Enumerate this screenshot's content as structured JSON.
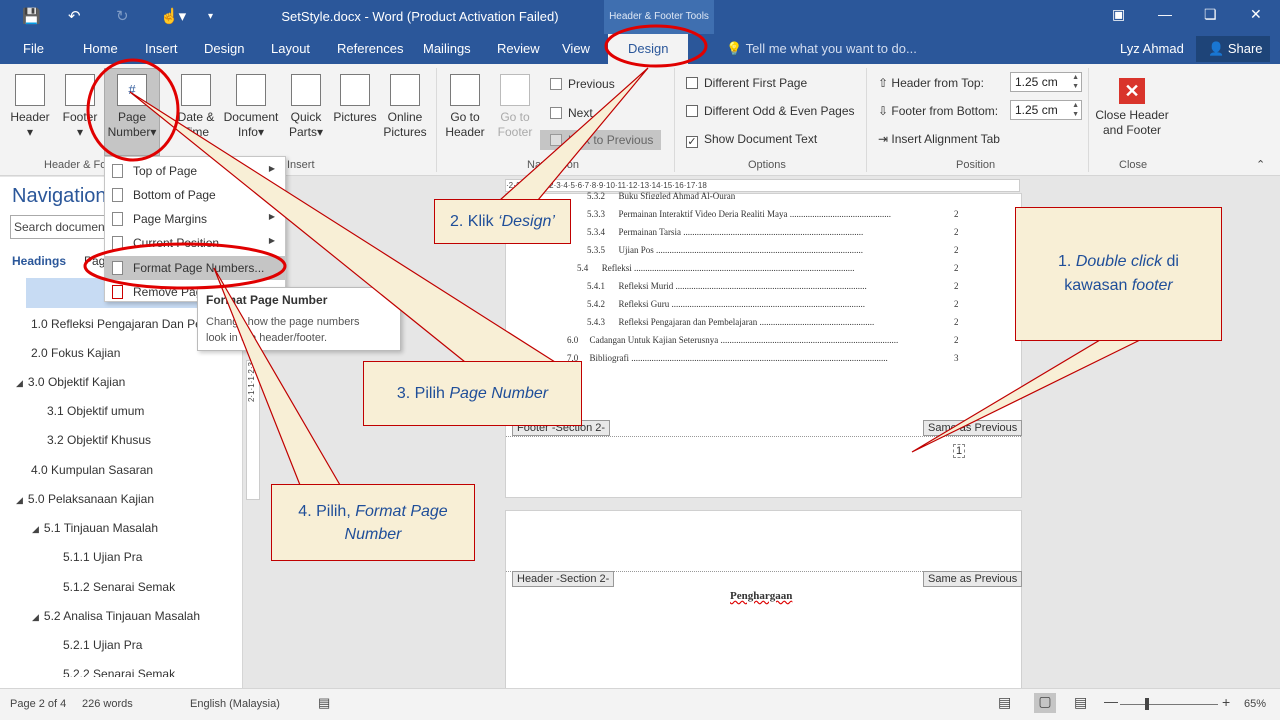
{
  "titlebar": {
    "title": "SetStyle.docx - Word (Product Activation Failed)",
    "context_tab": "Header & Footer Tools"
  },
  "tabs": {
    "file": "File",
    "home": "Home",
    "insert": "Insert",
    "design_doc": "Design",
    "layout": "Layout",
    "references": "References",
    "mailings": "Mailings",
    "review": "Review",
    "view": "View",
    "design_active": "Design",
    "tell_me": "Tell me what you want to do...",
    "user": "Lyz Ahmad",
    "share": "Share"
  },
  "ribbon": {
    "header": "Header",
    "footer": "Footer",
    "page_number_1": "Page",
    "page_number_2": "Number",
    "date_time_1": "Date &",
    "date_time_2": "Time",
    "document_info_1": "Document",
    "document_info_2": "Info",
    "quick_parts_1": "Quick",
    "quick_parts_2": "Parts",
    "pictures": "Pictures",
    "online_pictures_1": "Online",
    "online_pictures_2": "Pictures",
    "goto_header_1": "Go to",
    "goto_header_2": "Header",
    "goto_footer_1": "Go to",
    "goto_footer_2": "Footer",
    "previous": "Previous",
    "next": "Next",
    "link_to_previous": "Link to Previous",
    "different_first_page": "Different First Page",
    "different_odd_even": "Different Odd & Even Pages",
    "show_document_text": "Show Document Text",
    "header_from_top": "Header from Top:",
    "header_from_top_value": "1.25 cm",
    "footer_from_bottom": "Footer from Bottom:",
    "footer_from_bottom_value": "1.25 cm",
    "insert_alignment_tab": "Insert Alignment Tab",
    "close_1": "Close Header",
    "close_2": "and Footer",
    "group_header_footer": "Header & Fo",
    "group_insert": "Insert",
    "group_navigation": "Navigation",
    "group_options": "Options",
    "group_position": "Position",
    "group_close": "Close"
  },
  "dropdown": {
    "top_of_page": "Top of Page",
    "bottom_of_page": "Bottom of Page",
    "page_margins": "Page Margins",
    "current_position": "Current Position",
    "format_page_numbers": "Format Page Numbers...",
    "remove": "Remove Pag"
  },
  "tooltip": {
    "title": "Format Page Number",
    "desc_1": "Change how the page numbers",
    "desc_2": "look in the header/footer."
  },
  "nav": {
    "title": "Navigation",
    "search_placeholder": "Search document",
    "tab_headings": "Headings",
    "tab_pages": "Pag",
    "items": [
      "1.0 Refleksi Pengajaran Dan Pem",
      "2.0 Fokus Kajian",
      "3.0 Objektif Kajian",
      "3.1 Objektif umum",
      "3.2 Objektif Khusus",
      "4.0 Kumpulan Sasaran",
      "5.0 Pelaksanaan Kajian",
      "5.1 Tinjauan Masalah",
      "5.1.1 Ujian Pra",
      "5.1.2 Senarai Semak",
      "5.2 Analisa Tinjauan Masalah",
      "5.2.1 Ujian Pra",
      "5.2.2 Senarai Semak"
    ]
  },
  "ruler": {
    "h": "·2·1·1·1·  ·1·2·3·4·5·6·7·8·9·10·11·12·13·14·15·16·17·18",
    "v": "2·1·1·1·2·3"
  },
  "document": {
    "toc": [
      {
        "num": "5.3.2",
        "text": "Buku Sfiggled Ahmad Al-Quran",
        "page": "2"
      },
      {
        "num": "5.3.3",
        "text": "Permainan Interaktif Video Deria Realiti Maya",
        "page": "2"
      },
      {
        "num": "5.3.4",
        "text": "Permainan Tarsia",
        "page": "2"
      },
      {
        "num": "5.3.5",
        "text": "Ujian Pos",
        "page": "2"
      },
      {
        "num": "5.4",
        "text": "Refleksi",
        "page": "2"
      },
      {
        "num": "5.4.1",
        "text": "Refleksi Murid",
        "page": "2"
      },
      {
        "num": "5.4.2",
        "text": "Refleksi Guru",
        "page": "2"
      },
      {
        "num": "5.4.3",
        "text": "Refleksi Pengajaran dan Pembelajaran",
        "page": "2"
      },
      {
        "num": "6.0",
        "text": "Cadangan Untuk Kajian Seterusnya",
        "page": "2"
      },
      {
        "num": "7.0",
        "text": "Bibliografi",
        "page": "3"
      }
    ],
    "footer_tag": "Footer -Section 2-",
    "same_as_previous": "Same as Previous",
    "footer_page_num": "1",
    "header_tag": "Header -Section 2-",
    "same_as_previous_2": "Same as Previous",
    "next_heading": "Penghargaan"
  },
  "status": {
    "page": "Page 2 of 4",
    "words": "226 words",
    "language": "English (Malaysia)",
    "zoom": "65%"
  },
  "callouts": {
    "c1_num": "1.",
    "c1_em": "Double click",
    "c1_rest": "di",
    "c1_line2": "kawasan",
    "c1_em2": "footer",
    "c2_pre": "2. Klik",
    "c2_em": "‘Design’",
    "c3_pre": "3. Pilih",
    "c3_em": "Page Number",
    "c4_pre": "4. Pilih,",
    "c4_em": "Format Page",
    "c4_em2": "Number"
  },
  "colors": {
    "word_blue": "#2b579a",
    "annotation_red": "#e00000",
    "callout_fill": "#f8efd6",
    "callout_text": "#1f4e99"
  }
}
